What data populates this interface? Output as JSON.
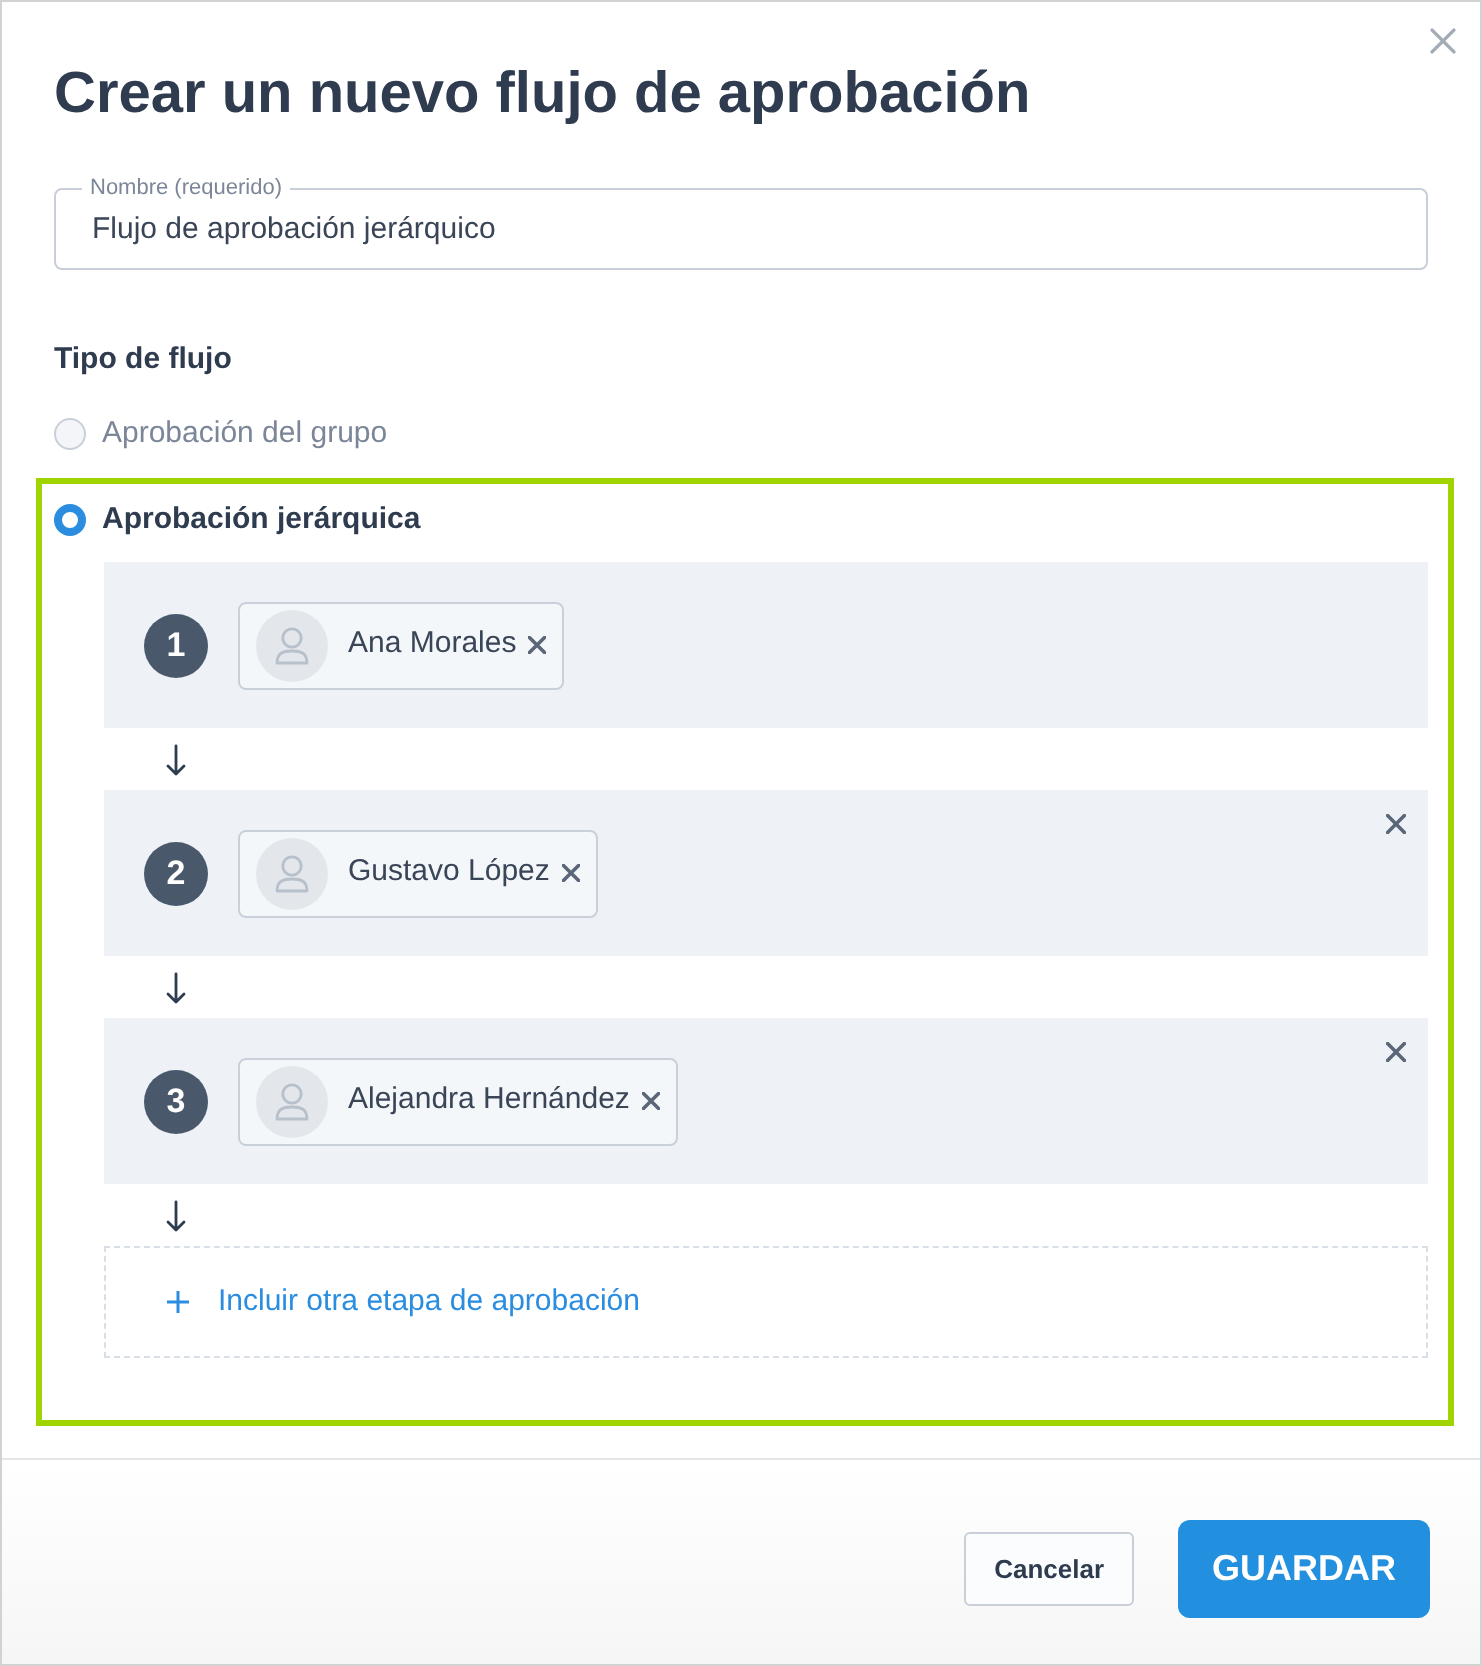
{
  "dialog": {
    "title": "Crear un nuevo flujo de aprobación"
  },
  "name_field": {
    "label": "Nombre (requerido)",
    "value": "Flujo de aprobación jerárquico"
  },
  "flow_type": {
    "heading": "Tipo de flujo",
    "options": [
      {
        "label": "Aprobación del grupo",
        "selected": false
      },
      {
        "label": "Aprobación jerárquica",
        "selected": true,
        "stages": [
          {
            "number": "1",
            "removable": false,
            "approvers": [
              {
                "name": "Ana Morales"
              }
            ]
          },
          {
            "number": "2",
            "removable": true,
            "approvers": [
              {
                "name": "Gustavo López"
              }
            ]
          },
          {
            "number": "3",
            "removable": true,
            "approvers": [
              {
                "name": "Alejandra Hernández"
              }
            ]
          }
        ],
        "add_stage": {
          "label": "Incluir otra etapa de aprobación"
        }
      }
    ]
  },
  "buttons": [
    {
      "label": "Cancelar",
      "kind": "secondary"
    },
    {
      "label": "GUARDAR",
      "kind": "primary"
    }
  ]
}
